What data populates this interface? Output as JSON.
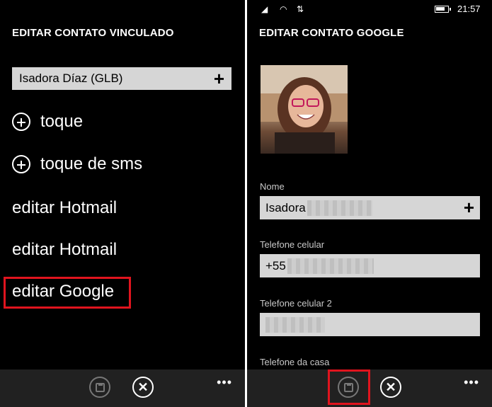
{
  "left": {
    "title": "EDITAR CONTATO VINCULADO",
    "linked_contact": "Isadora Díaz (GLB)",
    "ringtone_label": "toque",
    "sms_tone_label": "toque de sms",
    "edit_items": [
      "editar Hotmail",
      "editar Hotmail",
      "editar Google"
    ]
  },
  "right": {
    "status": {
      "time": "21:57"
    },
    "title": "EDITAR CONTATO GOOGLE",
    "fields": {
      "name_label": "Nome",
      "name_value": "Isadora",
      "mobile_label": "Telefone celular",
      "mobile_value": "+55",
      "mobile2_label": "Telefone celular 2",
      "home_label": "Telefone da casa"
    }
  },
  "appbar": {
    "more": "•••"
  },
  "colors": {
    "highlight": "#e0141e",
    "field_bg": "#d6d6d6",
    "appbar_bg": "#212121"
  }
}
